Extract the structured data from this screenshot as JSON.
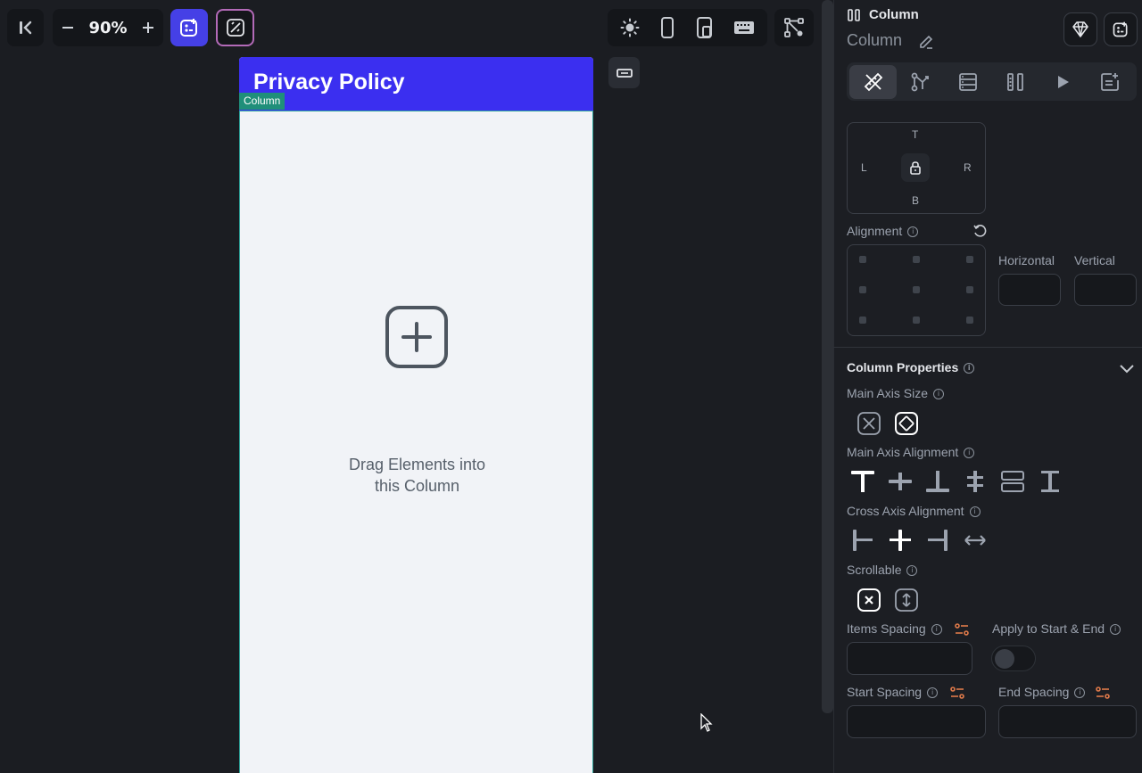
{
  "toolbar": {
    "zoom": "90%",
    "icons": [
      "collapse-panel-icon",
      "zoom-out-icon",
      "zoom-in-icon",
      "add-widget-icon",
      "ai-gen-icon",
      "sun-icon",
      "phone-icon",
      "tablet-icon",
      "keyboard-icon",
      "flow-icon"
    ]
  },
  "canvas": {
    "app_bar_title": "Privacy Policy",
    "column_tag": "Column",
    "drop_hint_line1": "Drag Elements into",
    "drop_hint_line2": "this Column"
  },
  "panel": {
    "header_title": "Column",
    "widget_name": "Column",
    "padding": {
      "top": "T",
      "left": "L",
      "right": "R",
      "bottom": "B"
    },
    "alignment_label": "Alignment",
    "horizontal_label": "Horizontal",
    "vertical_label": "Vertical",
    "section_title": "Column Properties",
    "main_axis_size_label": "Main Axis Size",
    "main_axis_alignment_label": "Main Axis Alignment",
    "cross_axis_alignment_label": "Cross Axis Alignment",
    "scrollable_label": "Scrollable",
    "items_spacing_label": "Items Spacing",
    "apply_start_end_label": "Apply to Start & End",
    "start_spacing_label": "Start Spacing",
    "end_spacing_label": "End Spacing",
    "accent_color": "#4540e6",
    "spacing_icon_color": "#e07a4a"
  }
}
